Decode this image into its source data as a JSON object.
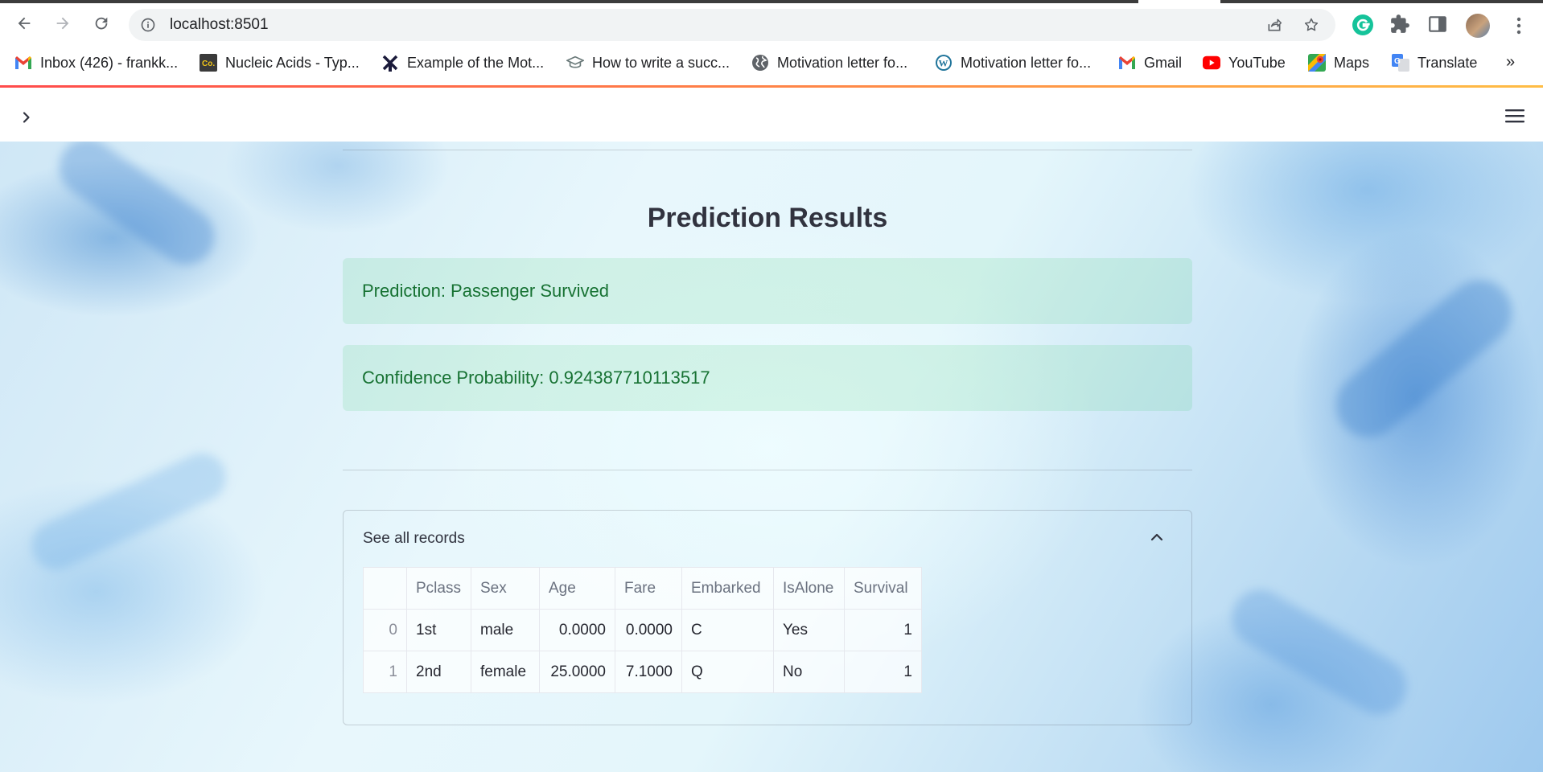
{
  "browser": {
    "url": "localhost:8501",
    "bookmarks": [
      {
        "label": "Inbox (426) - frankk...",
        "icon": "gmail-icon"
      },
      {
        "label": "Nucleic Acids - Typ...",
        "icon": "co-icon"
      },
      {
        "label": "Example of the Mot...",
        "icon": "windmill-icon"
      },
      {
        "label": "How to write a succ...",
        "icon": "graduation-cap-icon"
      },
      {
        "label": "Motivation letter fo...",
        "icon": "globe-icon"
      },
      {
        "label": "Motivation letter fo...",
        "icon": "wordpress-icon"
      },
      {
        "label": "Gmail",
        "icon": "gmail-icon"
      },
      {
        "label": "YouTube",
        "icon": "youtube-icon"
      },
      {
        "label": "Maps",
        "icon": "maps-icon"
      },
      {
        "label": "Translate",
        "icon": "translate-icon"
      }
    ],
    "more_glyph": "»"
  },
  "results": {
    "title": "Prediction Results",
    "prediction": "Prediction: Passenger Survived",
    "confidence": "Confidence Probability: 0.924387710113517"
  },
  "expander": {
    "label": "See all records",
    "expanded": true,
    "table": {
      "columns": [
        "",
        "Pclass",
        "Sex",
        "Age",
        "Fare",
        "Embarked",
        "IsAlone",
        "Survival"
      ],
      "rows": [
        [
          "0",
          "1st",
          "male",
          "0.0000",
          "0.0000",
          "C",
          "Yes",
          "1"
        ],
        [
          "1",
          "2nd",
          "female",
          "25.0000",
          "7.1000",
          "Q",
          "No",
          "1"
        ]
      ]
    }
  },
  "colors": {
    "success_text": "#177233",
    "success_bg": "rgba(33,195,84,0.12)",
    "header_accent_start": "#ff4b4b",
    "header_accent_end": "#ffbd45"
  }
}
